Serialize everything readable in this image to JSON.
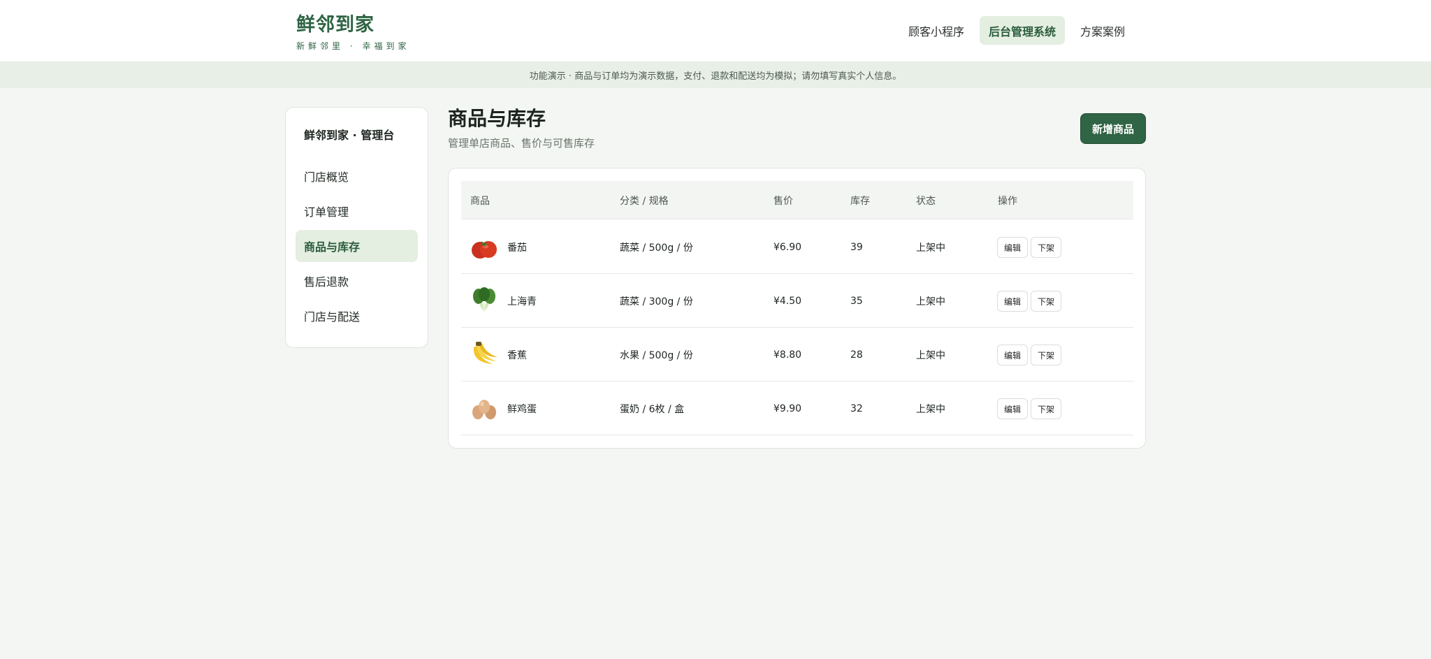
{
  "brand": {
    "name": "鲜邻到家",
    "slogan": "新鲜邻里 · 幸福到家"
  },
  "nav": {
    "items": [
      {
        "label": "顾客小程序",
        "active": false
      },
      {
        "label": "后台管理系统",
        "active": true
      },
      {
        "label": "方案案例",
        "active": false
      }
    ]
  },
  "notice": "功能演示 · 商品与订单均为演示数据，支付、退款和配送均为模拟；请勿填写真实个人信息。",
  "sidebar": {
    "title": "鲜邻到家 · 管理台",
    "items": [
      {
        "label": "门店概览",
        "active": false
      },
      {
        "label": "订单管理",
        "active": false
      },
      {
        "label": "商品与库存",
        "active": true
      },
      {
        "label": "售后退款",
        "active": false
      },
      {
        "label": "门店与配送",
        "active": false
      }
    ]
  },
  "main": {
    "title": "商品与库存",
    "subtitle": "管理单店商品、售价与可售库存",
    "add_button": "新增商品"
  },
  "table": {
    "headers": [
      "商品",
      "分类 / 规格",
      "售价",
      "库存",
      "状态",
      "操作"
    ],
    "rows": [
      {
        "icon": "tomato-icon",
        "name": "番茄",
        "spec": "蔬菜 / 500g / 份",
        "price": "¥6.90",
        "stock": "39",
        "status": "上架中",
        "edit": "编辑",
        "offline": "下架"
      },
      {
        "icon": "bok-choy-icon",
        "name": "上海青",
        "spec": "蔬菜 / 300g / 份",
        "price": "¥4.50",
        "stock": "35",
        "status": "上架中",
        "edit": "编辑",
        "offline": "下架"
      },
      {
        "icon": "banana-icon",
        "name": "香蕉",
        "spec": "水果 / 500g / 份",
        "price": "¥8.80",
        "stock": "28",
        "status": "上架中",
        "edit": "编辑",
        "offline": "下架"
      },
      {
        "icon": "eggs-icon",
        "name": "鲜鸡蛋",
        "spec": "蛋奶 / 6枚 / 盒",
        "price": "¥9.90",
        "stock": "32",
        "status": "上架中",
        "edit": "编辑",
        "offline": "下架"
      }
    ]
  },
  "colors": {
    "brand": "#2e6443",
    "accent_bg": "#e4eee1",
    "page_bg": "#f4f6f3",
    "primary_button": "#2f6444"
  }
}
